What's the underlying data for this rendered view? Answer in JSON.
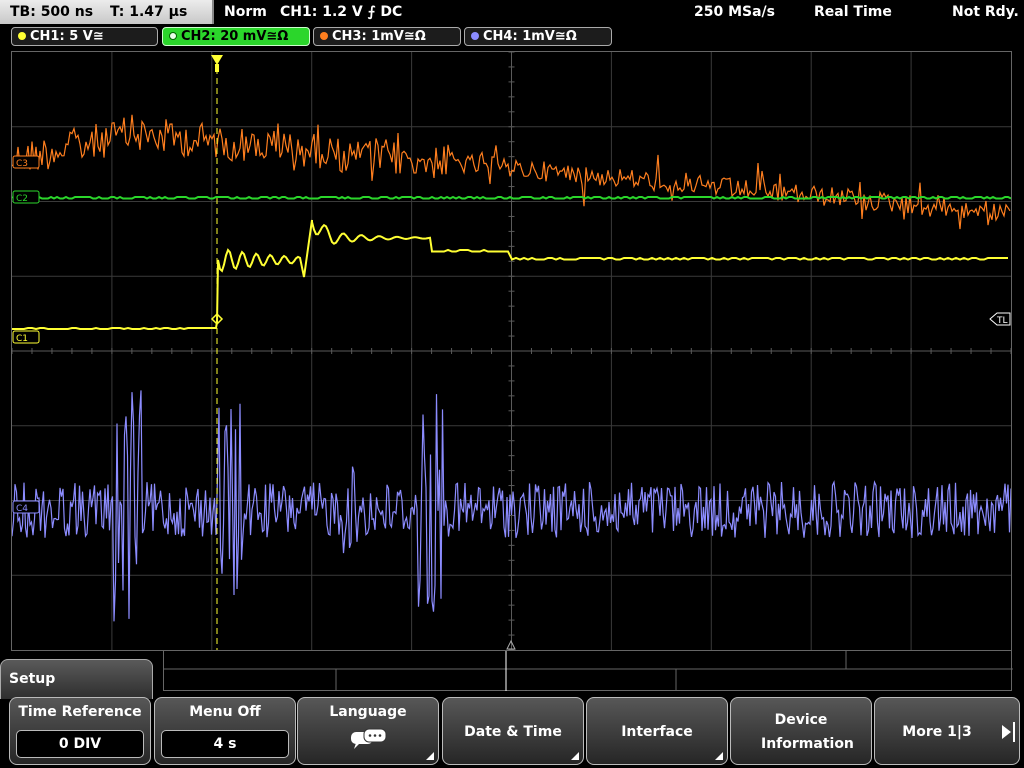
{
  "statusbar": {
    "timebase": "TB: 500 ns",
    "trigger_offset": "T: 1.47 µs",
    "trigger_mode": "Norm",
    "trigger_info": "CH1: 1.2 V ⨍ DC",
    "sample_rate": "250 MSa/s",
    "acq_mode": "Real Time",
    "state": "Not Rdy."
  },
  "channels": [
    {
      "label": "CH1: 5 V≅",
      "color": "#ffff33"
    },
    {
      "label": "CH2: 20 mV≅Ω",
      "color": "#2bd62b"
    },
    {
      "label": "CH3: 1mV≅Ω",
      "color": "#ff7f1f"
    },
    {
      "label": "CH4: 1mV≅Ω",
      "color": "#8c8cff"
    }
  ],
  "markers": {
    "ch1": "C1",
    "ch2": "C2",
    "ch3": "C3",
    "ch4": "C4",
    "trigger_level": "TL",
    "trigger_pos": "T"
  },
  "menu": {
    "title": "Setup",
    "buttons": [
      {
        "label": "Time Reference",
        "value": "0 DIV"
      },
      {
        "label": "Menu Off",
        "value": "4 s"
      },
      {
        "label": "Language",
        "icon": "speech-bubble-icon"
      },
      {
        "label": "Date & Time"
      },
      {
        "label": "Interface"
      },
      {
        "label": "Device Information"
      },
      {
        "label": "More 1|3"
      }
    ]
  }
}
